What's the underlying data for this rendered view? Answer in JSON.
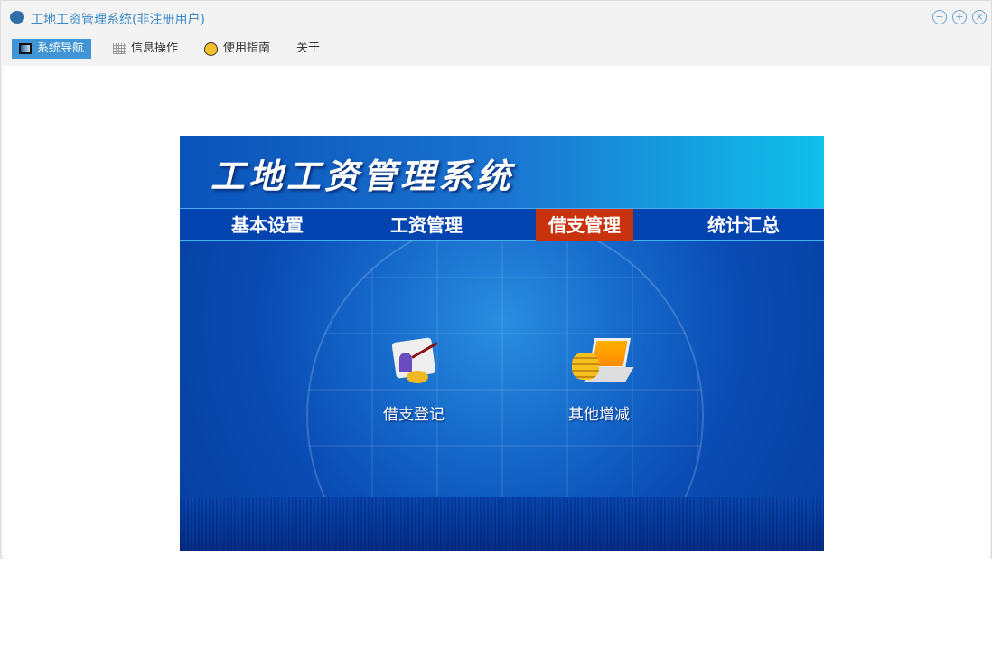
{
  "window": {
    "title": "工地工资管理系统(非注册用户)",
    "controls": [
      "minimize",
      "maximize",
      "close"
    ]
  },
  "menu": [
    {
      "label": "系统导航",
      "icon": "monitor-icon",
      "active": true
    },
    {
      "label": "信息操作",
      "icon": "grid-icon"
    },
    {
      "label": "使用指南",
      "icon": "help-icon"
    },
    {
      "label": "关于"
    }
  ],
  "banner": {
    "title": "工地工资管理系统",
    "nav": [
      {
        "label": "基本设置"
      },
      {
        "label": "工资管理"
      },
      {
        "label": "借支管理",
        "selected": true
      },
      {
        "label": "统计汇总"
      }
    ],
    "apps": [
      {
        "label": "借支登记",
        "icon": "loan-register-icon"
      },
      {
        "label": "其他增减",
        "icon": "coins-laptop-icon"
      }
    ]
  },
  "colors": {
    "accent": "#3f95d6",
    "selected_nav": "#c8320c",
    "title": "#3b8ac8"
  }
}
